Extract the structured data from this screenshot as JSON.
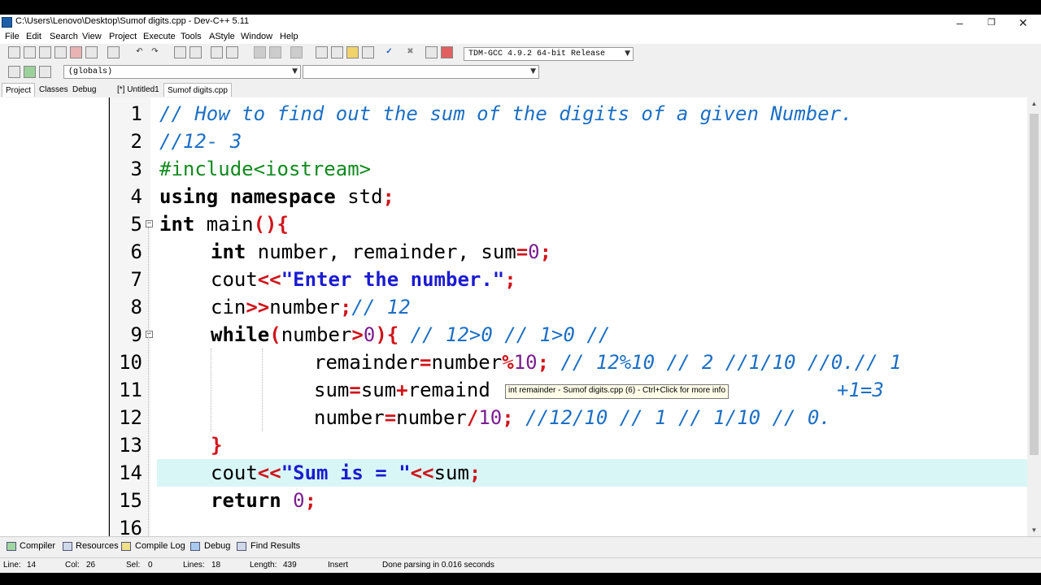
{
  "window": {
    "title": "C:\\Users\\Lenovo\\Desktop\\Sumof digits.cpp - Dev-C++ 5.11"
  },
  "menu": [
    "File",
    "Edit",
    "Search",
    "View",
    "Project",
    "Execute",
    "Tools",
    "AStyle",
    "Window",
    "Help"
  ],
  "toolbar": {
    "compiler_select": "TDM-GCC 4.9.2 64-bit Release",
    "scope_select": "(globals)"
  },
  "left_tabs": [
    "Project",
    "Classes",
    "Debug"
  ],
  "editor_tabs": [
    "[*] Untitled1",
    "Sumof digits.cpp"
  ],
  "active_editor_tab": "Sumof digits.cpp",
  "line_numbers": [
    "1",
    "2",
    "3",
    "4",
    "5",
    "6",
    "7",
    "8",
    "9",
    "10",
    "11",
    "12",
    "13",
    "14",
    "15",
    "16"
  ],
  "code": {
    "l1": "// How to find out the sum of the digits of a given Number.",
    "l2": "//12- 3",
    "l3": "#include<iostream>",
    "l4_kw": "using namespace",
    "l4_rest": " std",
    "l4_semi": ";",
    "l5_kw": "int",
    "l5_name": " main",
    "l5_paren": "(){",
    "l6_kw": "int",
    "l6_a": " number",
    "l6_b": ", remainder",
    "l6_c": ", sum",
    "l6_eq": "=",
    "l6_num": "0",
    "l6_semi": ";",
    "l7_a": "cout",
    "l7_op": "<<",
    "l7_str": "\"Enter the number.\"",
    "l7_semi": ";",
    "l8_a": "cin",
    "l8_op": ">>",
    "l8_b": "number",
    "l8_semi": ";",
    "l8_cm": "// 12",
    "l9_kw": "while",
    "l9_p1": "(",
    "l9_a": "number",
    "l9_gt": ">",
    "l9_num": "0",
    "l9_p2": "){",
    "l9_cm": " // 12>0 // 1>0 //",
    "l10_a": "remainder",
    "l10_eq": "=",
    "l10_b": "number",
    "l10_mod": "%",
    "l10_num": "10",
    "l10_semi": ";",
    "l10_cm": " // 12%10 // 2 //1/10 //0.// 1",
    "l11_a": "sum",
    "l11_eq": "=",
    "l11_b": "sum",
    "l11_plus": "+",
    "l11_c": "remaind",
    "l11_tail": "+1=3",
    "l12_a": "number",
    "l12_eq": "=",
    "l12_b": "number",
    "l12_div": "/",
    "l12_num": "10",
    "l12_semi": ";",
    "l12_cm": " //12/10 // 1 // 1/10 // 0.",
    "l13": "}",
    "l14_a": "cout",
    "l14_op": "<<",
    "l14_str": "\"Sum is = \"",
    "l14_op2": "<<",
    "l14_b": "sum",
    "l14_semi": ";",
    "l15_kw": "return",
    "l15_num": " 0",
    "l15_semi": ";"
  },
  "tooltip": "int remainder - Sumof digits.cpp (6) - Ctrl+Click for more info",
  "bottom_tabs": [
    "Compiler",
    "Resources",
    "Compile Log",
    "Debug",
    "Find Results"
  ],
  "status": {
    "line_label": "Line:",
    "line": "14",
    "col_label": "Col:",
    "col": "26",
    "sel_label": "Sel:",
    "sel": "0",
    "lines_label": "Lines:",
    "lines": "18",
    "length_label": "Length:",
    "length": "439",
    "mode": "Insert",
    "message": "Done parsing in 0.016 seconds"
  }
}
